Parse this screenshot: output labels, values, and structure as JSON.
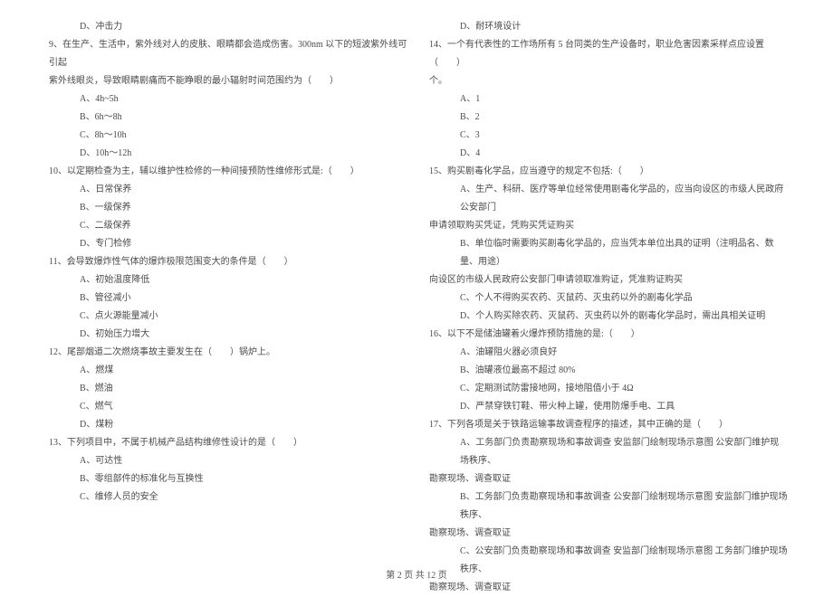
{
  "leftColumn": {
    "opt_d_prev": "D、冲击力",
    "q9": "9、在生产、生活中，紫外线对人的皮肤、眼睛都会造成伤害。300nm 以下的短波紫外线可引起",
    "q9_cont": "紫外线眼炎，导致眼睛剧痛而不能睁眼的最小辐射时间范围约为（　　）",
    "q9_a": "A、4h~5h",
    "q9_b": "B、6h～8h",
    "q9_c": "C、8h～10h",
    "q9_d": "D、10h～12h",
    "q10": "10、以定期检查为主，辅以维护性检修的一种间接预防性维修形式是:（　　）",
    "q10_a": "A、日常保养",
    "q10_b": "B、一级保养",
    "q10_c": "C、二级保养",
    "q10_d": "D、专门检修",
    "q11": "11、会导致爆炸性气体的爆炸极限范围变大的条件是（　　）",
    "q11_a": "A、初始温度降低",
    "q11_b": "B、管径减小",
    "q11_c": "C、点火源能量减小",
    "q11_d": "D、初始压力增大",
    "q12": "12、尾部烟道二次燃烧事故主要发生在（　　）锅炉上。",
    "q12_a": "A、燃煤",
    "q12_b": "B、燃油",
    "q12_c": "C、燃气",
    "q12_d": "D、煤粉",
    "q13": "13、下列项目中，不属于机械产品结构维修性设计的是（　　）",
    "q13_a": "A、可达性",
    "q13_b": "B、零组部件的标准化与互换性",
    "q13_c": "C、维修人员的安全"
  },
  "rightColumn": {
    "q13_d": "D、耐环境设计",
    "q14": "14、一个有代表性的工作场所有 5 台同类的生产设备时，职业危害因素采样点应设置（　　）",
    "q14_cont": "个。",
    "q14_a": "A、1",
    "q14_b": "B、2",
    "q14_c": "C、3",
    "q14_d": "D、4",
    "q15": "15、购买剧毒化学品，应当遵守的规定不包括:（　　）",
    "q15_a": "A、生产、科研、医疗等单位经常使用剧毒化学品的，应当向设区的市级人民政府公安部门",
    "q15_a_cont": "申请领取购买凭证，凭购买凭证购买",
    "q15_b": "B、单位临时需要购买剧毒化学品的，应当凭本单位出具的证明（注明品名、数量、用途）",
    "q15_b_cont": "向设区的市级人民政府公安部门申请领取准购证，凭准购证购买",
    "q15_c": "C、个人不得购买农药、灭鼠药、灭虫药以外的剧毒化学品",
    "q15_d": "D、个人购买除农药、灭鼠药、灭虫药以外的剧毒化学品时，需出具相关证明",
    "q16": "16、以下不是储油罐着火爆炸预防措施的是:（　　）",
    "q16_a": "A、油罐阻火器必须良好",
    "q16_b": "B、油罐液位最高不超过 80%",
    "q16_c": "C、定期测试防雷接地网，接地阻值小于 4Ω",
    "q16_d": "D、严禁穿铁钉鞋、带火种上罐，使用防爆手电、工具",
    "q17": "17、下列各项是关于铁路运输事故调查程序的描述，其中正确的是（　　）",
    "q17_a": "A、工务部门负责勘察现场和事故调查 安监部门绘制现场示意图 公安部门维护现场秩序、",
    "q17_a_cont": "勘察现场、调查取证",
    "q17_b": "B、工务部门负责勘察现场和事故调查 公安部门绘制现场示意图 安监部门维护现场秩序、",
    "q17_b_cont": "勘察现场、调查取证",
    "q17_c": "C、公安部门负责勘察现场和事故调查 安监部门绘制现场示意图 工务部门维护现场秩序、",
    "q17_c_cont": "勘察现场、调查取证"
  },
  "footer": "第 2 页 共 12 页"
}
